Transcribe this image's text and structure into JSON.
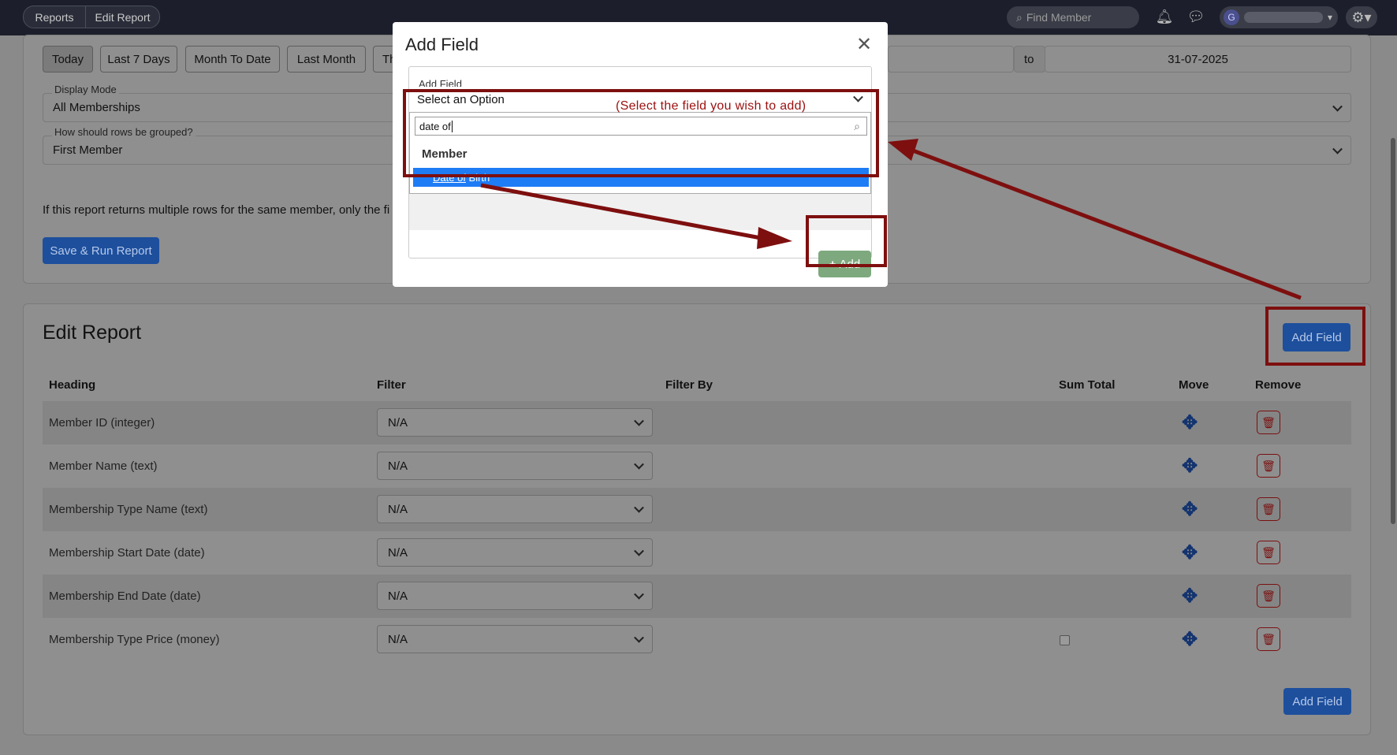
{
  "topbar": {
    "breadcrumb": [
      "Reports",
      "Edit Report"
    ],
    "search_placeholder": "Find Member",
    "user_initial": "G"
  },
  "filters": {
    "date_ranges": [
      "Today",
      "Last 7 Days",
      "Month To Date",
      "Last Month",
      "Th"
    ],
    "selected_range": "Today",
    "to_label": "to",
    "end_date": "31-07-2025",
    "display_mode": {
      "label": "Display Mode",
      "value": "All Memberships"
    },
    "grouping": {
      "label": "How should rows be grouped?",
      "value": "First Member"
    },
    "info_text": "If this report returns multiple rows for the same member, only the fi",
    "save_button": "Save & Run Report"
  },
  "edit_report": {
    "title": "Edit Report",
    "add_field_button": "Add Field",
    "columns": [
      "Heading",
      "Filter",
      "Filter By",
      "Sum Total",
      "Move",
      "Remove"
    ],
    "rows": [
      {
        "heading": "Member ID (integer)",
        "filter": "N/A"
      },
      {
        "heading": "Member Name (text)",
        "filter": "N/A"
      },
      {
        "heading": "Membership Type Name (text)",
        "filter": "N/A"
      },
      {
        "heading": "Membership Start Date (date)",
        "filter": "N/A"
      },
      {
        "heading": "Membership End Date (date)",
        "filter": "N/A"
      },
      {
        "heading": "Membership Type Price (money)",
        "filter": "N/A"
      }
    ],
    "bottom_add_field_button": "Add Field"
  },
  "modal": {
    "title": "Add Field",
    "field_label": "Add Field",
    "select_value": "Select an Option",
    "search_text": "date of",
    "group_label": "Member",
    "option_match": "Date of",
    "option_rest": " Birth",
    "add_button": "Add"
  },
  "annotation": {
    "text": "(Select the field you wish to add)",
    "color": "#7e0f0f"
  },
  "colors": {
    "primary": "#1d4f9c",
    "highlight": "#1e7cf5",
    "success": "#7ea97e",
    "danger": "#7a1010"
  }
}
